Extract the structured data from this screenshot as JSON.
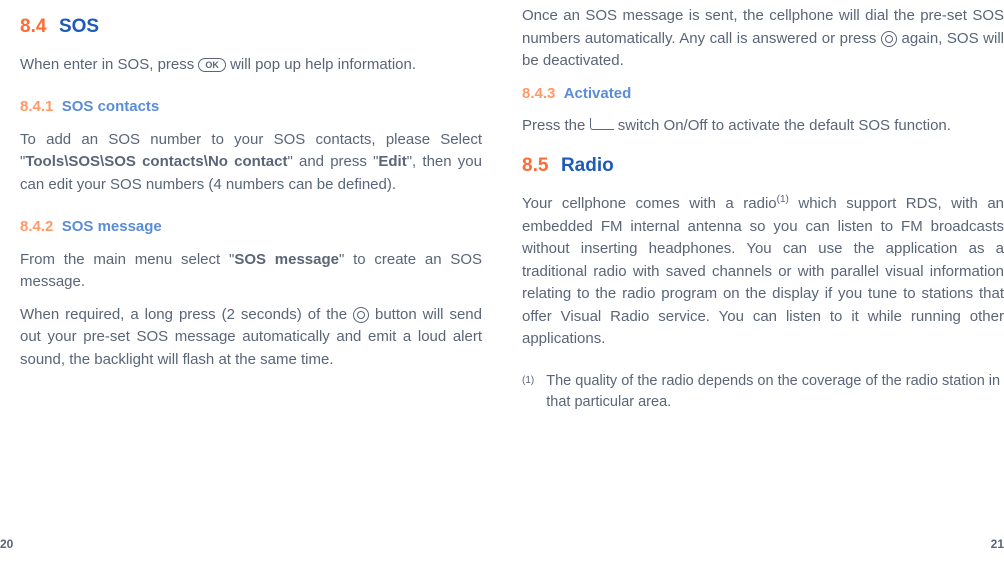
{
  "left": {
    "section_num": "8.4",
    "section_title": "SOS",
    "intro_a": "When enter in SOS, press ",
    "intro_ok": "OK",
    "intro_b": " will  pop up help information.",
    "sub1_num": "8.4.1",
    "sub1_title": "SOS contacts",
    "p1_a": "To add an SOS number to your SOS contacts, please Select \"",
    "p1_bold1": "Tools\\SOS\\SOS contacts\\No contact",
    "p1_b": "\" and press \"",
    "p1_bold2": "Edit",
    "p1_c": "\", then you can edit your SOS numbers (4 numbers can be defined).",
    "sub2_num": "8.4.2",
    "sub2_title": "SOS message",
    "p2_a": "From the main menu select \"",
    "p2_bold": "SOS message",
    "p2_b": "\" to create an SOS message.",
    "p3_a": "When required, a long press (2 seconds) of the ",
    "p3_b": " button will send out your pre-set SOS message automatically and emit a loud alert sound, the backlight will flash at the same time.",
    "page_num": "20"
  },
  "right": {
    "p1_a": "Once an SOS message is sent, the cellphone will dial the pre-set SOS numbers automatically. Any call is answered or press ",
    "p1_b": " again, SOS will be deactivated.",
    "sub3_num": "8.4.3",
    "sub3_title": "Activated",
    "p2_a": "Press the ",
    "p2_b": " switch On/Off to activate the default SOS function.",
    "section_num": "8.5",
    "section_title": "Radio",
    "p3_a": "Your cellphone comes with a radio",
    "p3_sup": "(1)",
    "p3_b": " which support RDS, with an embedded FM internal antenna so you can listen to FM broadcasts without inserting headphones. You can use the application as a traditional radio with saved channels or with parallel visual information relating to the radio program on the display if you tune to stations that offer Visual Radio service. You can listen to it while running other applications.",
    "footnote_marker": "(1)",
    "footnote_text": "The quality of the radio depends on the coverage of the radio station in that particular area.",
    "page_num": "21"
  }
}
